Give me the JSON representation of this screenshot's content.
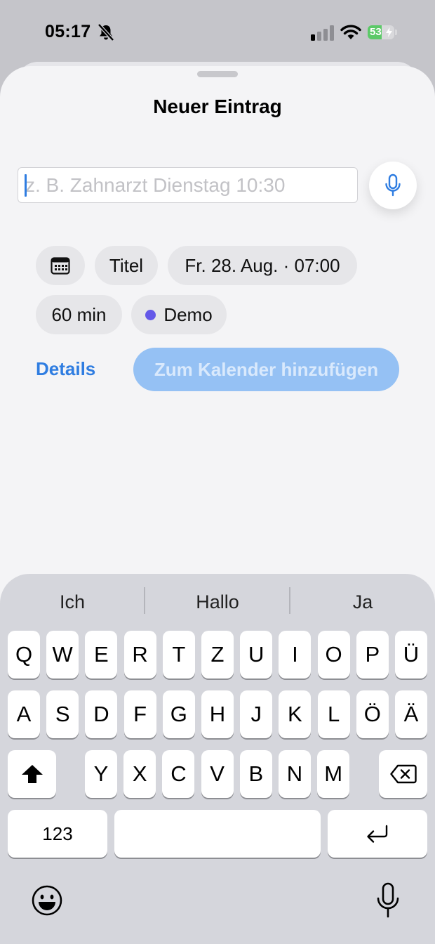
{
  "status_bar": {
    "time": "05:17",
    "battery_level": 53,
    "battery_label": "53",
    "icons": [
      "bell-slash-icon",
      "cellular-signal-icon",
      "wifi-icon",
      "battery-charging-icon"
    ]
  },
  "sheet": {
    "title": "Neuer Eintrag",
    "input": {
      "value": "",
      "placeholder": "z. B. Zahnarzt Dienstag 10:30"
    },
    "chips": {
      "calendar_icon": "calendar-icon",
      "title": "Titel",
      "datetime": "Fr. 28. Aug. · 07:00",
      "duration": "60 min",
      "calendar_name": "Demo"
    },
    "details_label": "Details",
    "add_button_label": "Zum Kalender hinzufügen"
  },
  "keyboard": {
    "suggestions": [
      "Ich",
      "Hallo",
      "Ja"
    ],
    "row1": [
      "Q",
      "W",
      "E",
      "R",
      "T",
      "Z",
      "U",
      "I",
      "O",
      "P",
      "Ü"
    ],
    "row2": [
      "A",
      "S",
      "D",
      "F",
      "G",
      "H",
      "J",
      "K",
      "L",
      "Ö",
      "Ä"
    ],
    "row3": [
      "Y",
      "X",
      "C",
      "V",
      "B",
      "N",
      "M"
    ],
    "numbers_label": "123",
    "space_label": "",
    "icons": [
      "shift-icon",
      "backspace-icon",
      "return-icon",
      "emoji-icon",
      "dictation-mic-icon"
    ]
  },
  "colors": {
    "accent": "#2f7de1",
    "button_disabled": "#95c1f4",
    "calendar_dot": "#6458e8",
    "battery_green": "#5cc968"
  }
}
